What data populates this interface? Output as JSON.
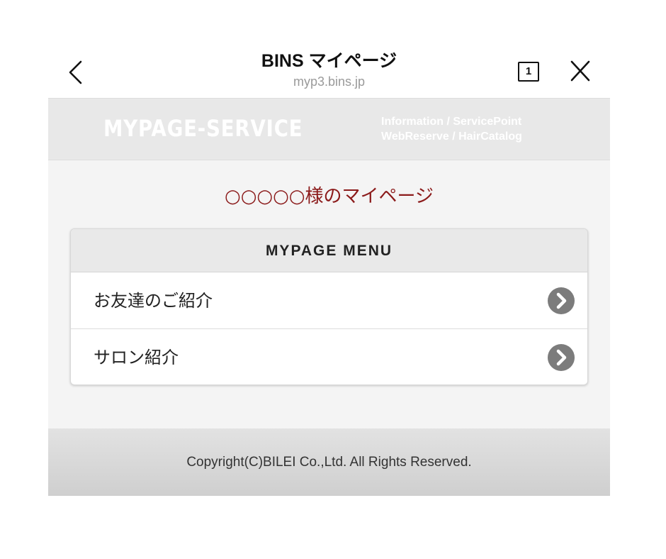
{
  "browser": {
    "title": "BINS マイページ",
    "url": "myp3.bins.jp",
    "tab_count": "1"
  },
  "header": {
    "brand": "MYPAGE-SERVICE",
    "links_line1": "Information / ServicePoint",
    "links_line2": "WebReserve / HairCatalog"
  },
  "main": {
    "greeting": "○○○○○様のマイページ",
    "menu": {
      "title": "MYPAGE MENU",
      "items": [
        {
          "label": "お友達のご紹介"
        },
        {
          "label": "サロン紹介"
        }
      ]
    }
  },
  "footer": {
    "copyright": "Copyright(C)BILEI Co.,Ltd. All Rights Reserved."
  },
  "colors": {
    "accent": "#8b1a1a",
    "chevron": "#7c7c7c",
    "header_bg": "#e8e8e8"
  }
}
